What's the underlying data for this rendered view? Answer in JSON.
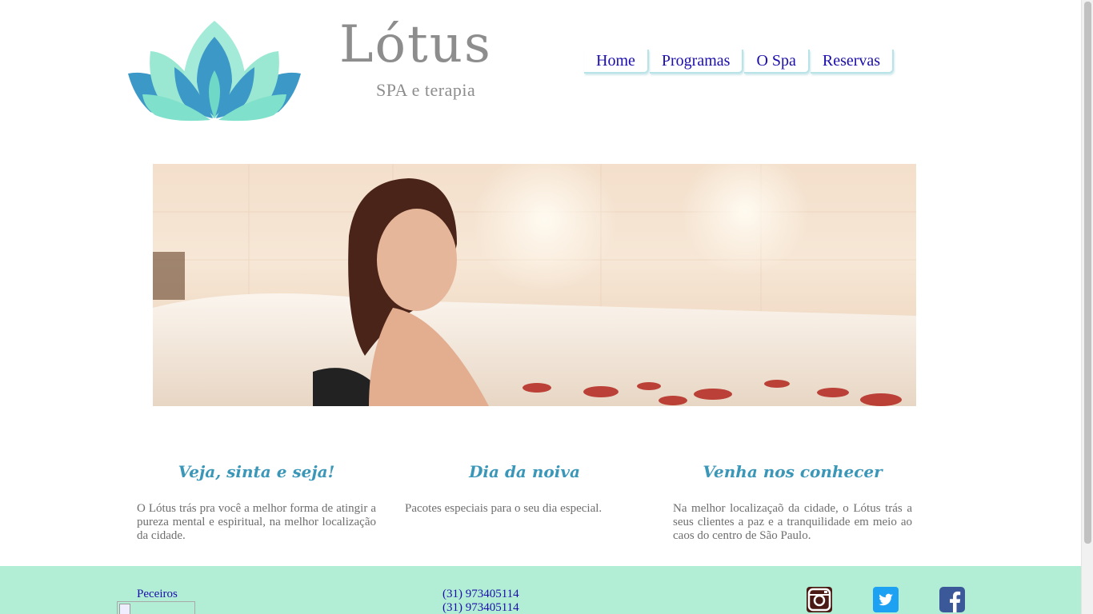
{
  "brand": {
    "name": "Lótus",
    "tagline": "SPA e terapia"
  },
  "nav": {
    "items": [
      "Home",
      "Programas",
      "O Spa",
      "Reservas"
    ]
  },
  "features": [
    {
      "title": "Veja, sinta e seja!",
      "text": "O Lótus trás pra você a melhor forma de atingir a pureza mental e espiritual, na melhor localização da cidade."
    },
    {
      "title": "Dia da noiva",
      "text": "Pacotes especiais para o seu dia especial."
    },
    {
      "title": "Venha nos conhecer",
      "text": "Na melhor localizaçaõ da cidade, o Lótus trás a seus clientes a paz e a tranquilidade em meio ao caos do centro de São Paulo."
    }
  ],
  "footer": {
    "partners_label": "Peceiros",
    "phones": [
      "(31) 973405114",
      "(31) 973405114"
    ],
    "social": [
      "instagram-icon",
      "twitter-icon",
      "facebook-icon"
    ]
  },
  "colors": {
    "accent": "#3b97b8",
    "footer_bg": "#b2eed5",
    "link": "#1a0dab",
    "logo_teal": "#3aa0c8",
    "logo_mint": "#8fe3cc"
  }
}
